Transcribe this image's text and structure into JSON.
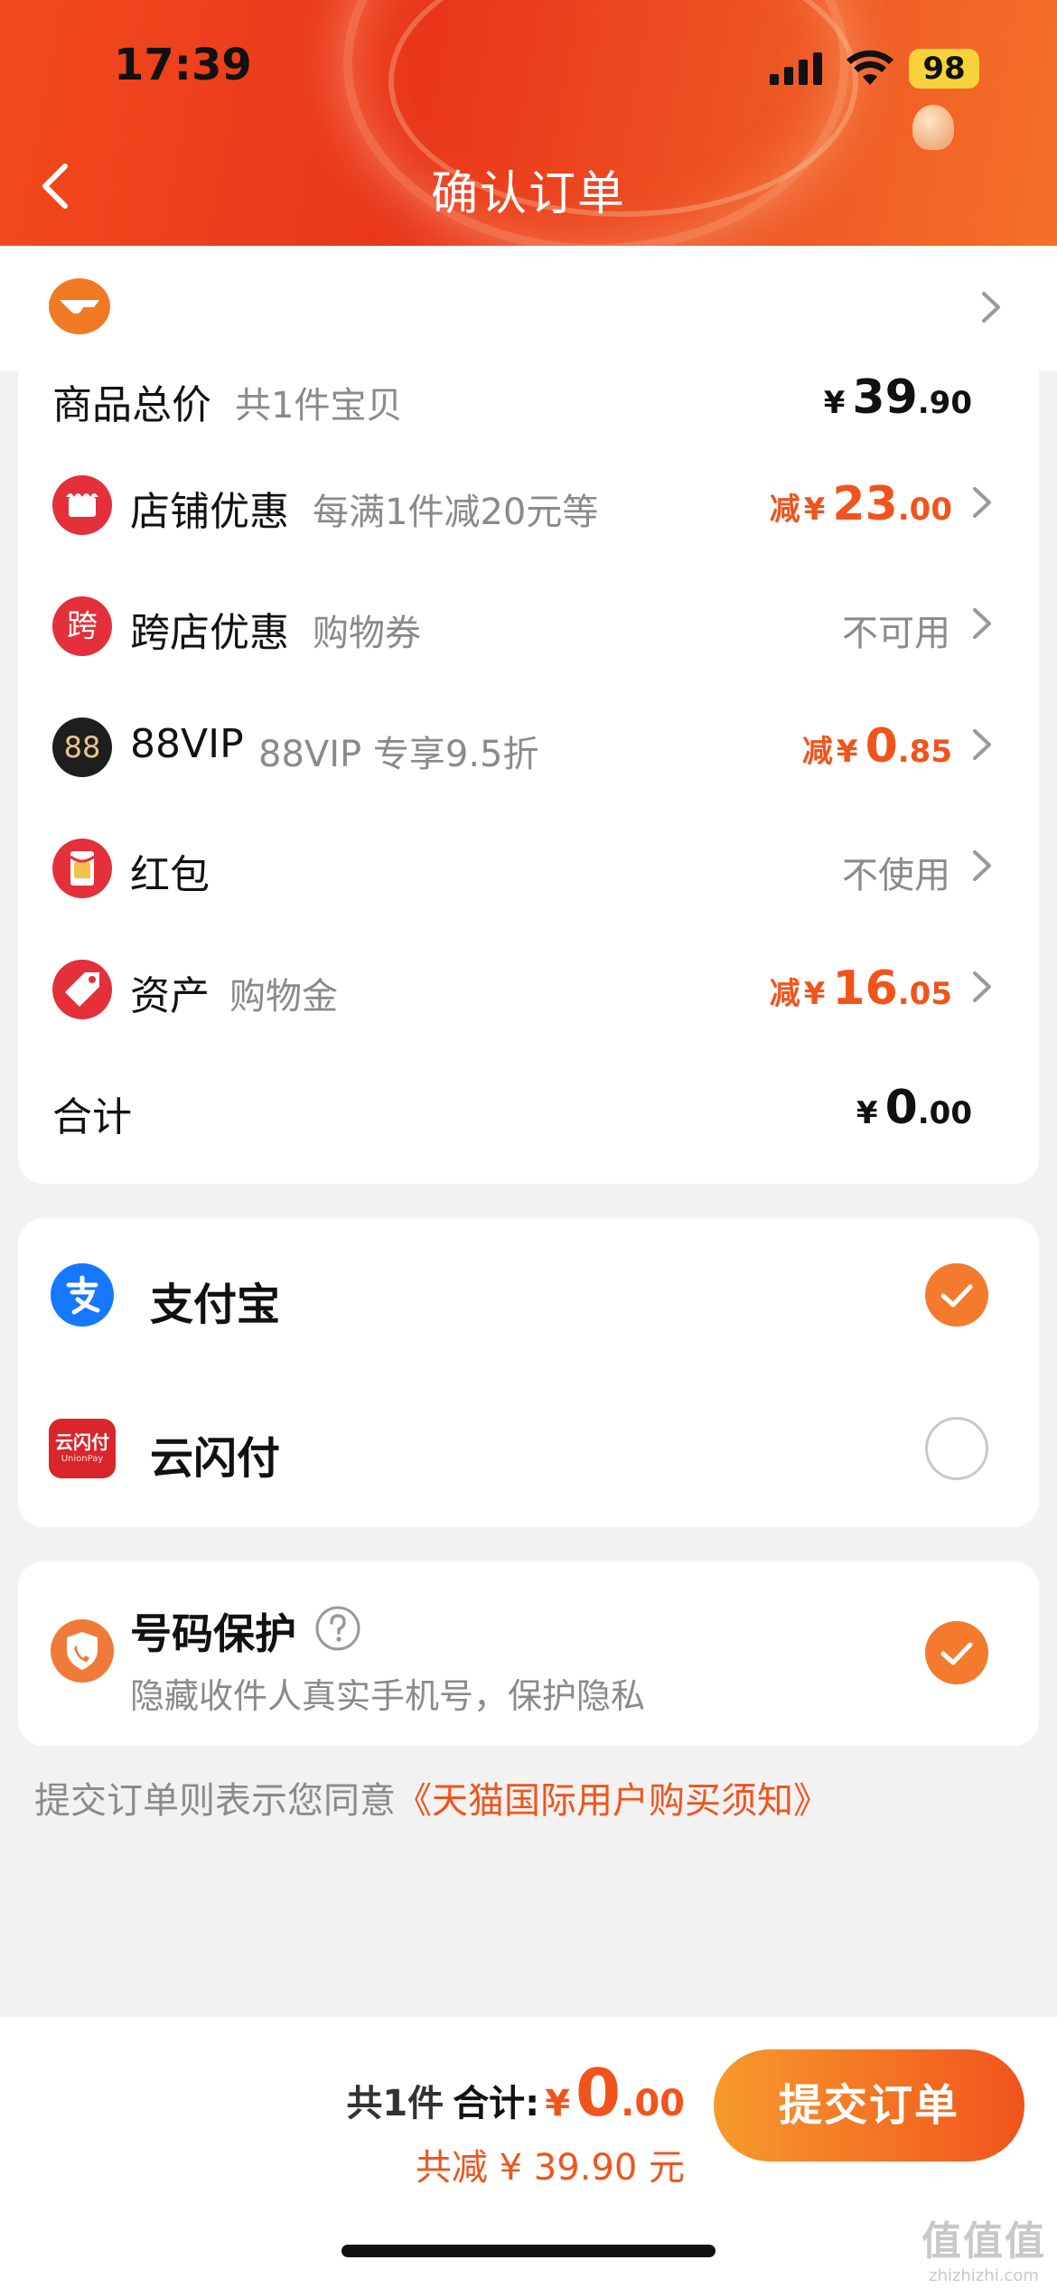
{
  "status_bar": {
    "time": "17:39",
    "battery": "98"
  },
  "header": {
    "title": "确认订单"
  },
  "order": {
    "goods_total": {
      "label": "商品总价",
      "sub": "共1件宝贝",
      "yen": "¥",
      "int": "39",
      "dec": ".90"
    },
    "rows": [
      {
        "label": "店铺优惠",
        "sub": "每满1件减20元等",
        "type": "discount",
        "prefix": "减",
        "yen": "¥",
        "int": "23",
        "dec": ".00",
        "icon": "store-icon",
        "color": "#e3303b"
      },
      {
        "label": "跨店优惠",
        "sub": "购物券",
        "type": "text",
        "value": "不可用",
        "icon": "cross-store-icon",
        "glyph": "跨",
        "color": "#e3303b"
      },
      {
        "label": "88VIP",
        "sub": "88VIP 专享9.5折",
        "type": "discount",
        "prefix": "减",
        "yen": "¥",
        "int": "0",
        "dec": ".85",
        "icon": "vip88-icon",
        "glyph": "88",
        "color": "#1e1e1e"
      },
      {
        "label": "红包",
        "sub": "",
        "type": "text",
        "value": "不使用",
        "icon": "red-packet-icon",
        "color": "#e3303b"
      },
      {
        "label": "资产",
        "sub": "购物金",
        "type": "discount",
        "prefix": "减",
        "yen": "¥",
        "int": "16",
        "dec": ".05",
        "icon": "tag-icon",
        "color": "#e3303b"
      }
    ],
    "total": {
      "label": "合计",
      "yen": "¥",
      "int": "0",
      "dec": ".00"
    }
  },
  "payment": {
    "methods": [
      {
        "label": "支付宝",
        "selected": true,
        "icon": "alipay-icon"
      },
      {
        "label": "云闪付",
        "selected": false,
        "icon": "unionpay-quickpass-icon",
        "icon_text": "云闪付",
        "icon_sub": "UnionPay"
      }
    ]
  },
  "privacy": {
    "title": "号码保护",
    "desc": "隐藏收件人真实手机号，保护隐私",
    "selected": true
  },
  "agreement": {
    "prefix": "提交订单则表示您同意",
    "link": "《天猫国际用户购买须知》"
  },
  "bottom": {
    "count": "共1件",
    "total_label": "合计:",
    "yen": "¥",
    "int": "0",
    "dec": ".00",
    "saved": "共减 ¥ 39.90 元",
    "submit": "提交订单"
  },
  "watermark": {
    "title": "值值值",
    "url": "zhizhizhi.com"
  },
  "colors": {
    "accent": "#f0541c",
    "header": "#ea3a1b",
    "alipay": "#1677ff",
    "unionpay": "#d8262b"
  }
}
